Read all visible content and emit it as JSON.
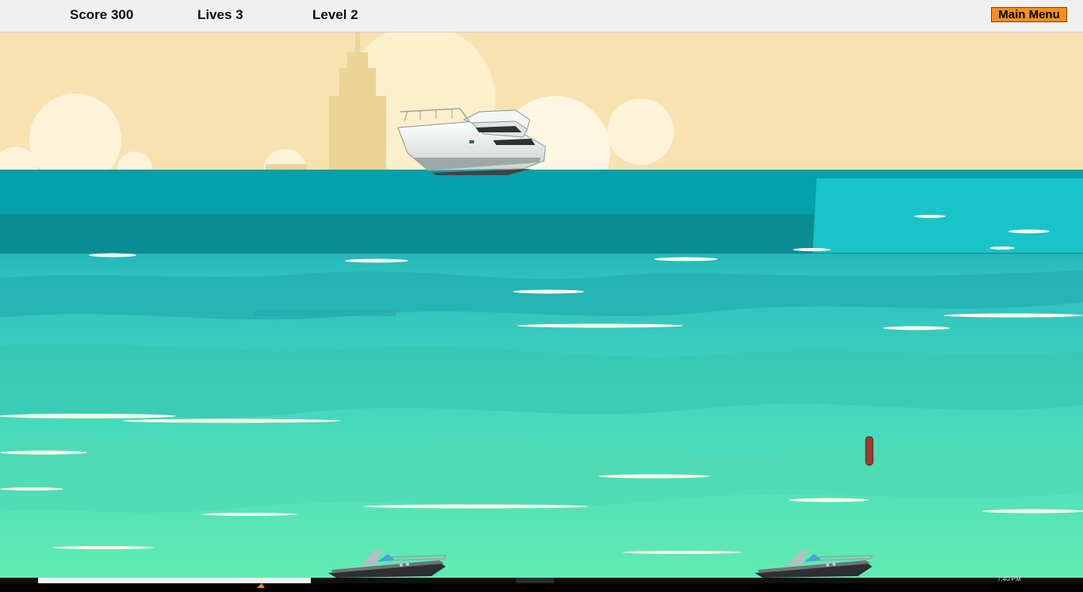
{
  "hud": {
    "score_text": "Score 300",
    "lives_text": "Lives 3",
    "level_text": "Level 2",
    "main_menu_label": "Main Menu"
  },
  "game": {
    "score": 300,
    "lives": 3,
    "level": 2
  },
  "colors": {
    "hud_background": "#f0f0f0",
    "menu_button": "#f5901e",
    "sky": "#f7e2b0",
    "sea_top": "#0aa3ad",
    "sea_bottom": "#5fe8b5",
    "torpedo": "#a13a2e"
  },
  "sprites": {
    "enemy": "white-yacht",
    "player": "speedboat-icon",
    "projectile": "torpedo"
  },
  "taskbar": {
    "clock_text": "7:40 PM"
  }
}
